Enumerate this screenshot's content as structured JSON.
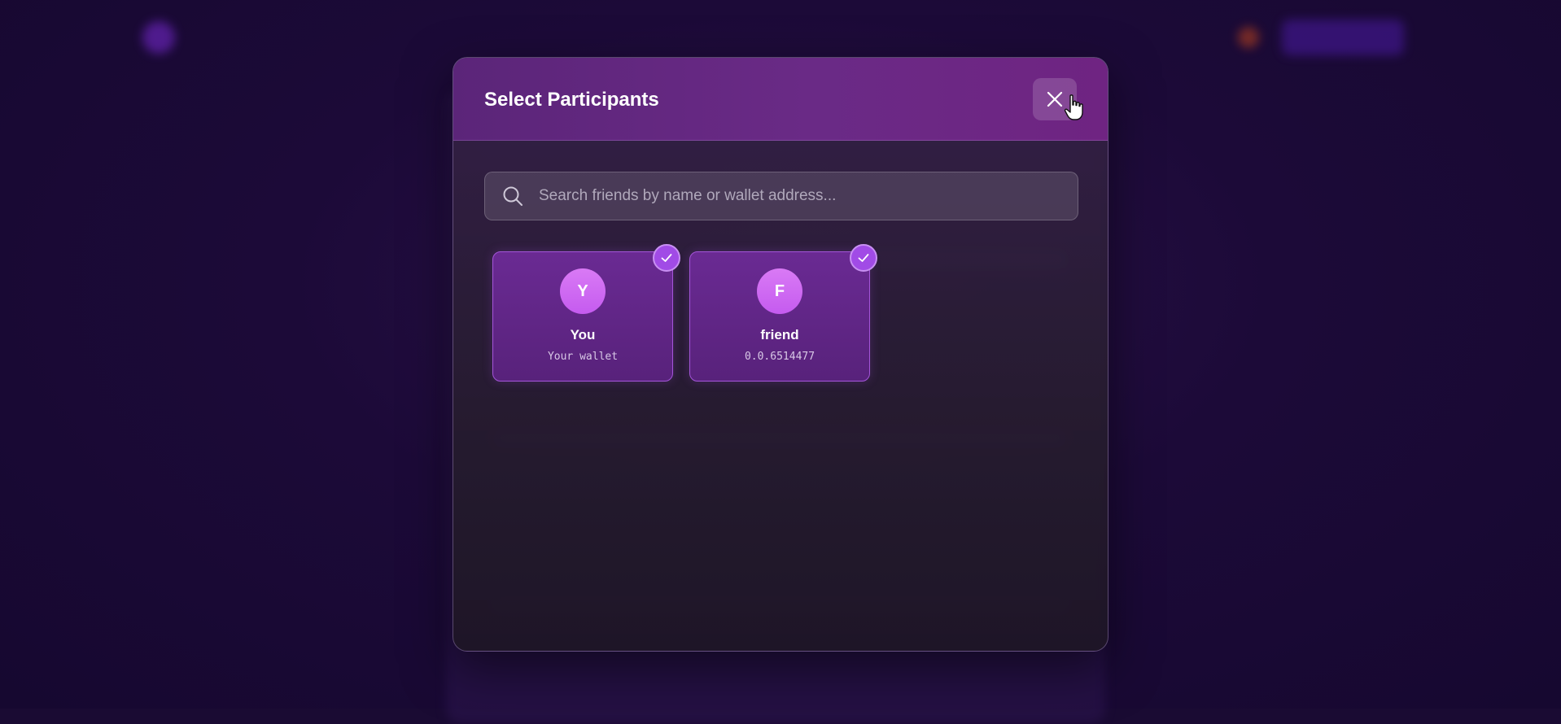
{
  "modal": {
    "title": "Select Participants",
    "close_icon": "close-icon"
  },
  "search": {
    "placeholder": "Search friends by name or wallet address...",
    "value": ""
  },
  "participants": [
    {
      "initial": "Y",
      "name": "You",
      "subtitle": "Your wallet",
      "selected": true
    },
    {
      "initial": "F",
      "name": "friend",
      "subtitle": "0.0.6514477",
      "selected": true
    }
  ],
  "colors": {
    "accent": "#a14be6",
    "header": "#6a2a86",
    "avatar": "#d06cf2",
    "background": "#1a0b33"
  }
}
